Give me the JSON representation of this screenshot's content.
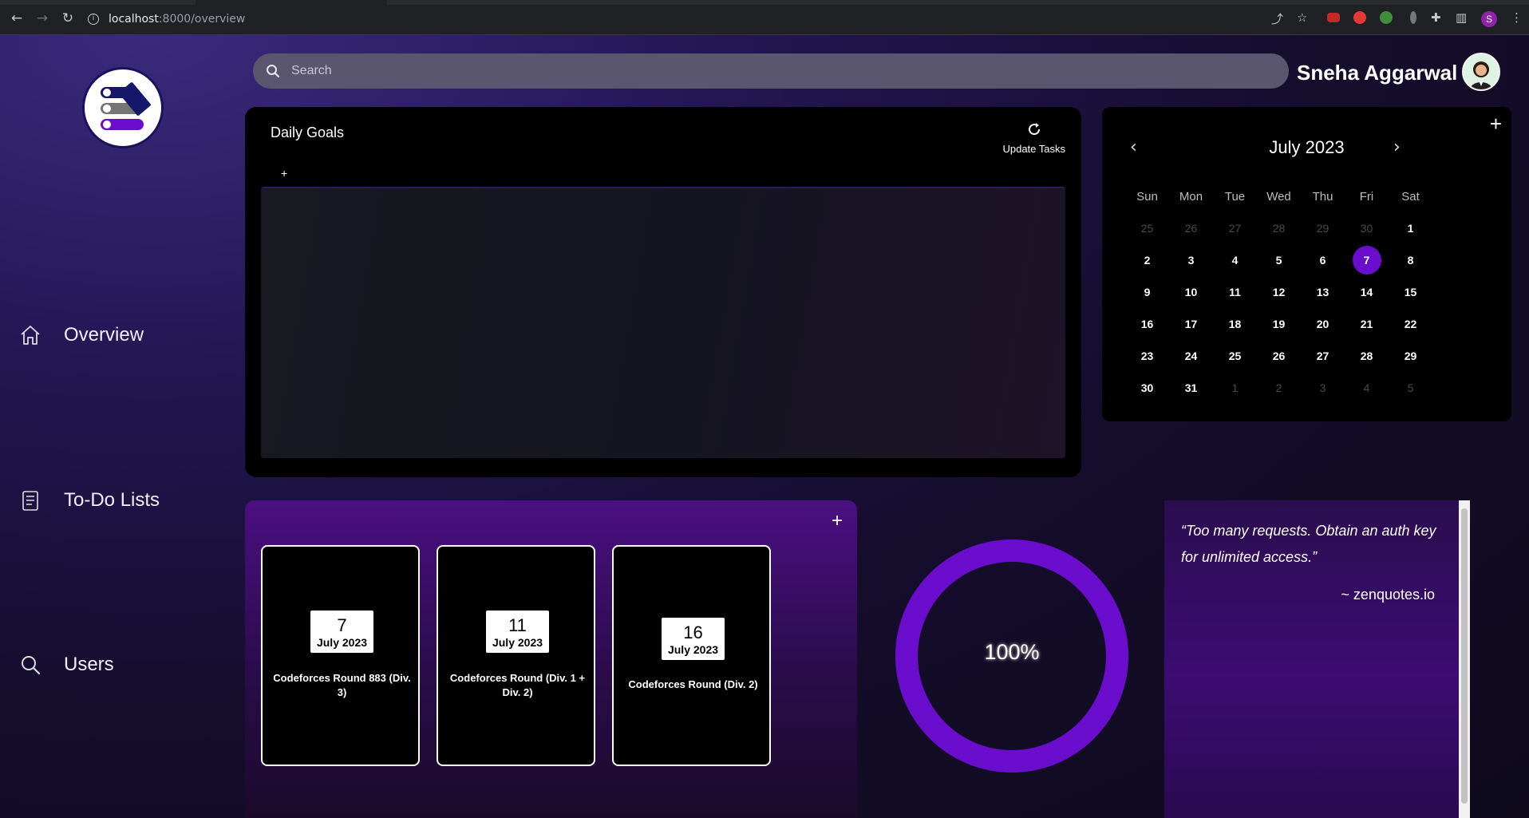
{
  "browser": {
    "url_host": "localhost",
    "url_path": ":8000/overview",
    "profile_initial": "S"
  },
  "sidebar": {
    "items": [
      {
        "label": "Overview",
        "icon": "home-icon"
      },
      {
        "label": "To-Do Lists",
        "icon": "clipboard-list-icon"
      },
      {
        "label": "Users",
        "icon": "search-icon"
      }
    ]
  },
  "header": {
    "search_placeholder": "Search",
    "user_name": "Sneha Aggarwal"
  },
  "daily_goals": {
    "title": "Daily Goals",
    "update_label": "Update Tasks",
    "add_label": "+"
  },
  "calendar": {
    "add_label": "+",
    "month_label": "July 2023",
    "prev_label": "‹",
    "next_label": "›",
    "weekdays": [
      "Sun",
      "Mon",
      "Tue",
      "Wed",
      "Thu",
      "Fri",
      "Sat"
    ],
    "weeks": [
      [
        "25",
        "26",
        "27",
        "28",
        "29",
        "30",
        "1"
      ],
      [
        "2",
        "3",
        "4",
        "5",
        "6",
        "7",
        "8"
      ],
      [
        "9",
        "10",
        "11",
        "12",
        "13",
        "14",
        "15"
      ],
      [
        "16",
        "17",
        "18",
        "19",
        "20",
        "21",
        "22"
      ],
      [
        "23",
        "24",
        "25",
        "26",
        "27",
        "28",
        "29"
      ],
      [
        "30",
        "31",
        "1",
        "2",
        "3",
        "4",
        "5"
      ]
    ],
    "selected_day": "7",
    "accent": "#6a0dcc"
  },
  "contests": {
    "add_label": "+",
    "cards": [
      {
        "day": "7",
        "month": "July 2023",
        "name": "Codeforces Round 883 (Div. 3)"
      },
      {
        "day": "11",
        "month": "July 2023",
        "name": "Codeforces Round (Div. 1 + Div. 2)"
      },
      {
        "day": "16",
        "month": "July 2023",
        "name": "Codeforces Round (Div. 2)"
      }
    ]
  },
  "progress": {
    "label": "100%",
    "value": 1.0,
    "color": "#6a0dcc"
  },
  "quote": {
    "text": "“Too many requests. Obtain an auth key for unlimited access.”",
    "author": "~ zenquotes.io"
  }
}
